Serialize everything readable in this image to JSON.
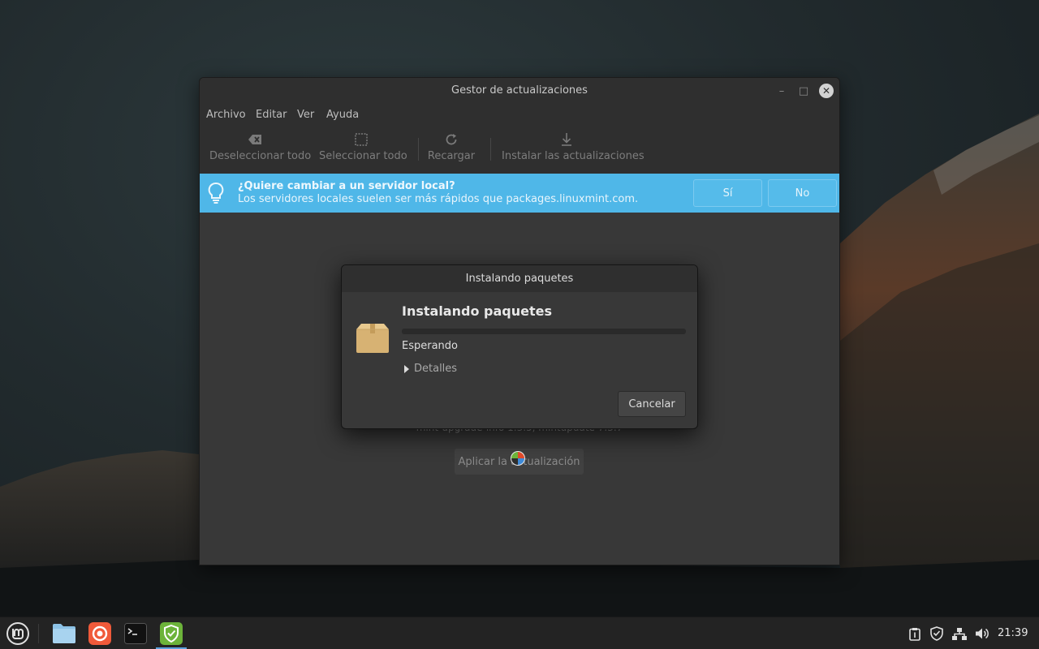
{
  "window": {
    "title": "Gestor de actualizaciones",
    "controls": {
      "minimize": "–",
      "maximize": "□",
      "close": "✕"
    }
  },
  "menu": [
    "Archivo",
    "Editar",
    "Ver",
    "Ayuda"
  ],
  "toolbar": {
    "deselect_all": "Deseleccionar todo",
    "select_all": "Seleccionar todo",
    "reload": "Recargar",
    "install": "Instalar las actualizaciones"
  },
  "infobar": {
    "title": "¿Quiere cambiar a un servidor local?",
    "subtitle": "Los servidores locales suelen ser más rápidos que packages.linuxmint.com.",
    "yes": "Sí",
    "no": "No",
    "color": "#4fb7e8"
  },
  "main": {
    "version_text": "mint-upgrade-info 1.3.5, mintupdate 7.3.7",
    "apply_label": "Aplicar la actualización"
  },
  "dialog": {
    "title": "Instalando paquetes",
    "heading": "Instalando paquetes",
    "status": "Esperando",
    "details_label": "Detalles",
    "cancel_label": "Cancelar",
    "progress": 0
  },
  "taskbar": {
    "launchers": [
      "mint-menu-icon",
      "files-icon",
      "firefox-icon",
      "terminal-icon",
      "update-manager-icon"
    ],
    "tray": [
      "clipboard-icon",
      "shield-icon",
      "network-icon",
      "volume-icon"
    ],
    "clock": "21:39",
    "accent": "#5aa0dd"
  }
}
